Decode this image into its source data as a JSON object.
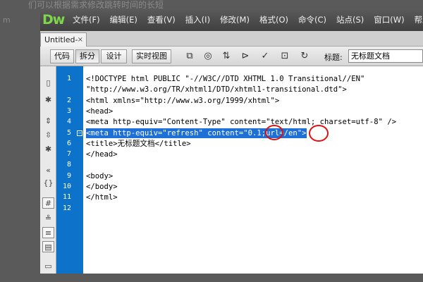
{
  "background": {
    "top_text": "们可以根据需求修改跳转时间的长短",
    "side_text": "m"
  },
  "app": {
    "logo": "Dw",
    "menu": [
      "文件(F)",
      "编辑(E)",
      "查看(V)",
      "插入(I)",
      "修改(M)",
      "格式(O)",
      "命令(C)",
      "站点(S)",
      "窗口(W)",
      "帮助"
    ]
  },
  "tab": {
    "label": "Untitled-1*",
    "close": "×"
  },
  "toolbar": {
    "code_label": "代码",
    "split_label": "拆分",
    "design_label": "设计",
    "live_label": "实时视图",
    "title_label": "标题:",
    "title_value": "无标题文档"
  },
  "line_numbers": [
    "1",
    "2",
    "3",
    "4",
    "5",
    "6",
    "7",
    "8",
    "9",
    "10",
    "11",
    "12"
  ],
  "code_lines": [
    "<!DOCTYPE html PUBLIC \"-//W3C//DTD XHTML 1.0 Transitional//EN\"",
    "\"http://www.w3.org/TR/xhtml1/DTD/xhtml1-transitional.dtd\">",
    "<html xmlns=\"http://www.w3.org/1999/xhtml\">",
    "<head>",
    "<meta http-equiv=\"Content-Type\" content=\"text/html; charset=utf-8\" />",
    "<meta http-equiv=\"refresh\" content=\"0.1;url=/en\">",
    "<title>无标题文档</title>",
    "</head>",
    "",
    "<body>",
    "</body>",
    "</html>"
  ],
  "colors": {
    "gutter_blue": "#0d72c9",
    "selection": "#1e6fd6",
    "annotation": "#e01010",
    "logo": "#7ed64a"
  }
}
